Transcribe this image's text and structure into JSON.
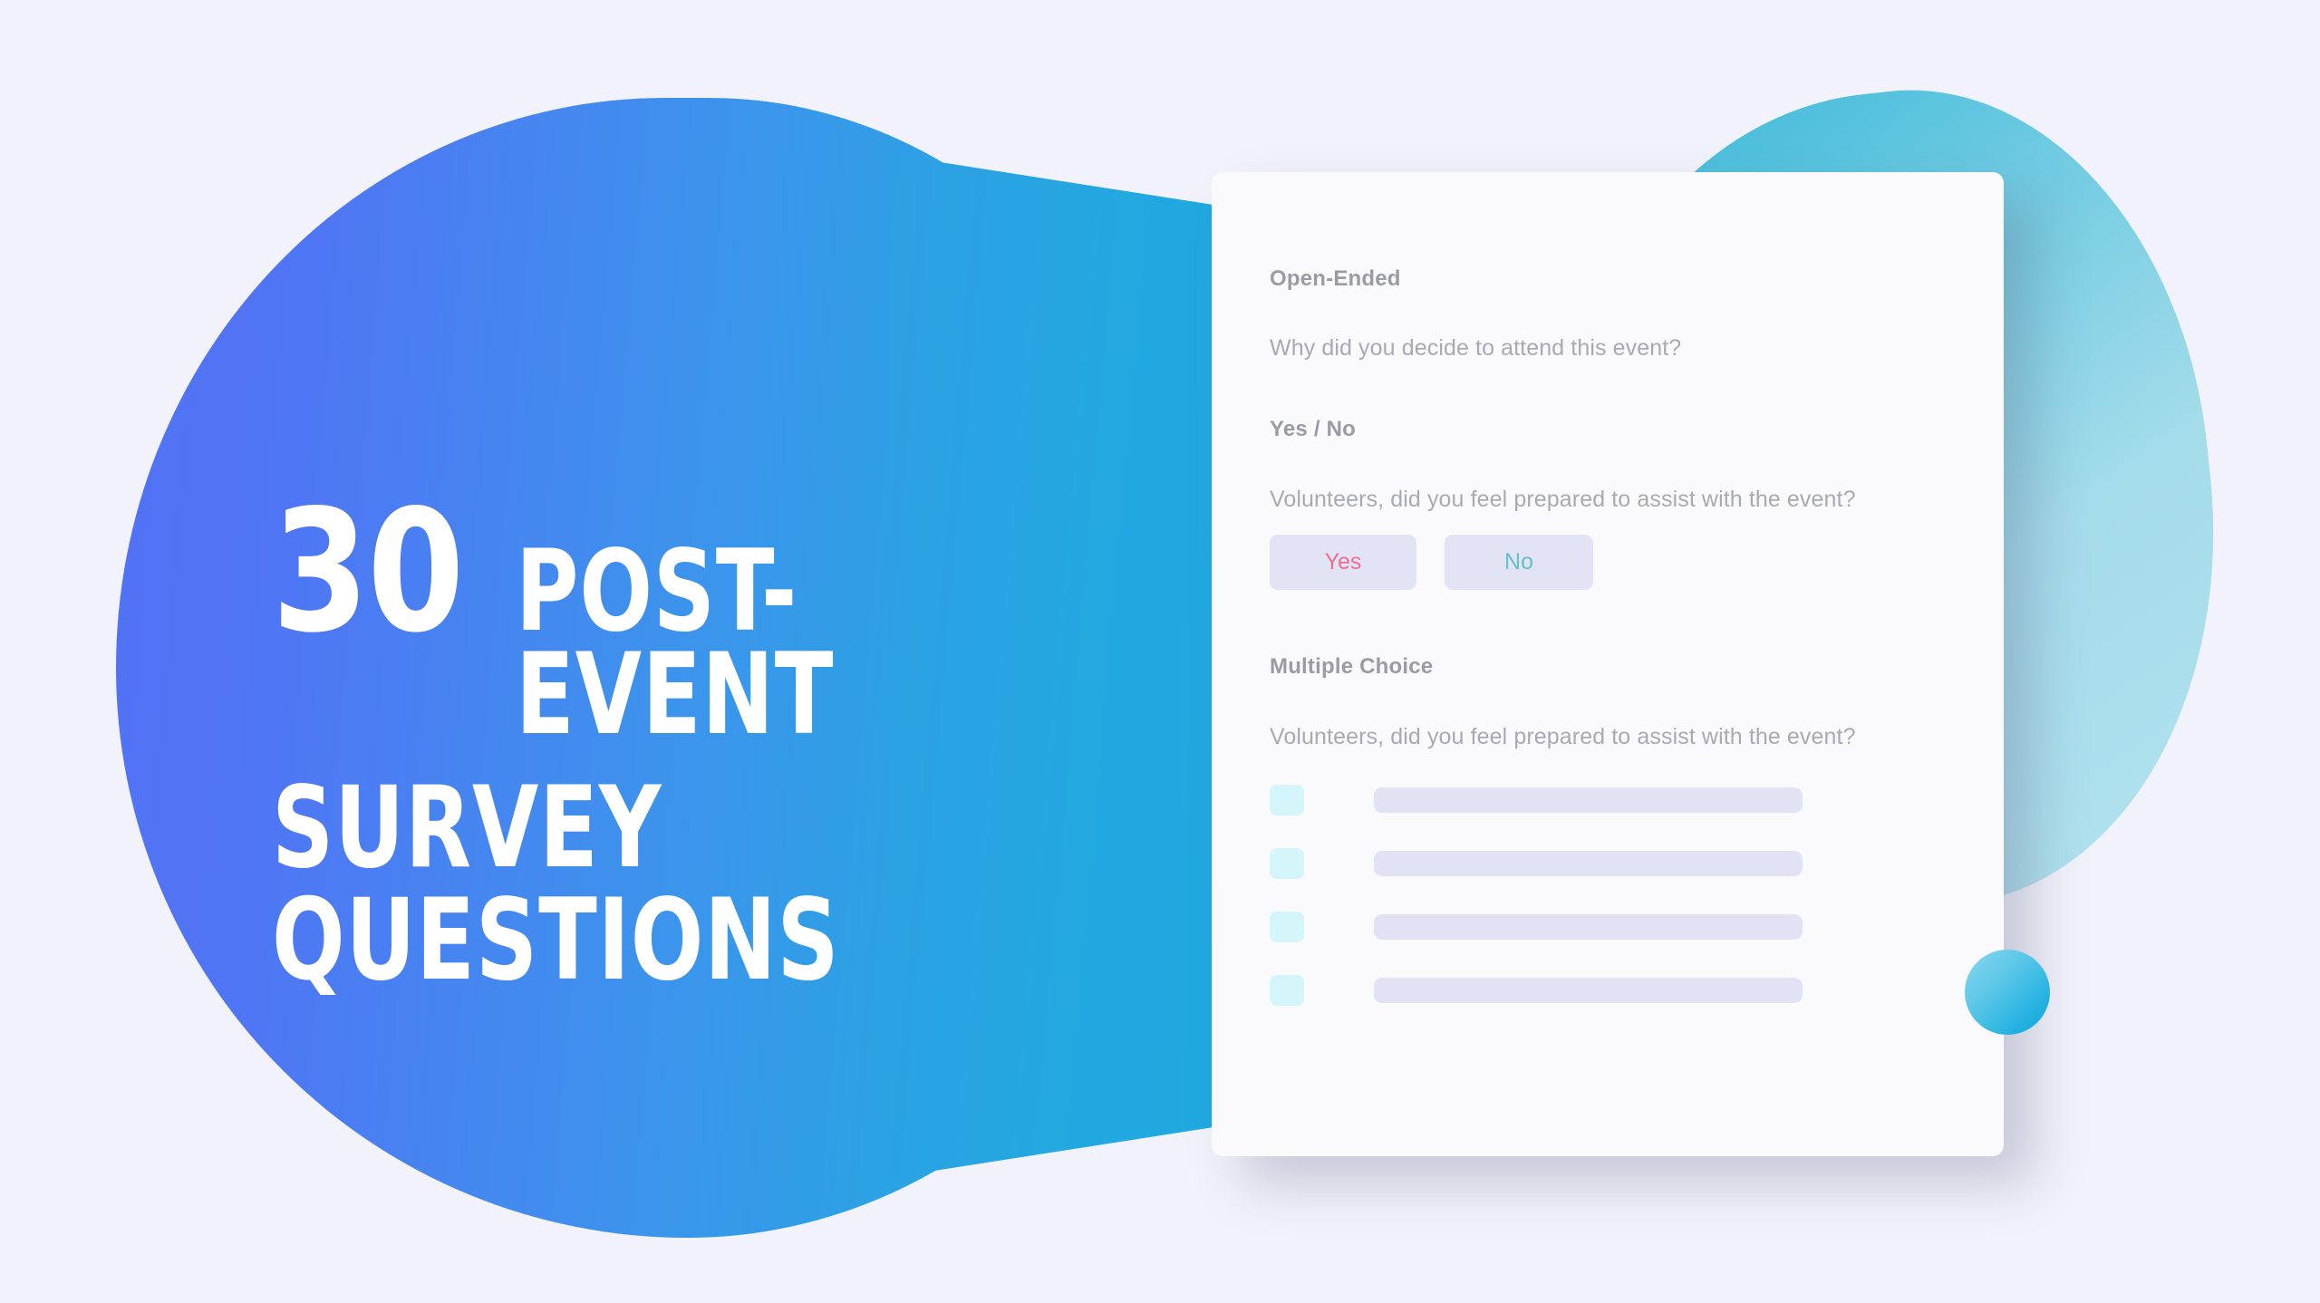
{
  "theme": {
    "page_background": "#f1f2fb",
    "blob_blue_from": "#5271f5",
    "blob_blue_to": "#1fa9df",
    "blob_teal_from": "#35b6d8",
    "blob_teal_to": "#b3e2ef",
    "circle_from": "#8ad7ee",
    "circle_to": "#13a9dd",
    "card_background": "#fafafc",
    "label_color": "#9b9ba6",
    "question_color": "#a9a9b4",
    "button_background": "#e3e3f6",
    "yes_color": "#ef6f8e",
    "no_color": "#63c2c9",
    "checkbox_color": "#d4f6fb",
    "placeholder_bar_color": "#e2e2f5"
  },
  "hero": {
    "count": "30",
    "headline_line1": "POST-EVENT",
    "headline_line2": "SURVEY QUESTIONS"
  },
  "card": {
    "sections": [
      {
        "label": "Open-Ended",
        "question": "Why did you decide to attend this event?"
      },
      {
        "label": "Yes / No",
        "question": "Volunteers, did you feel prepared to assist with the event?",
        "options": [
          {
            "label": "Yes",
            "name": "yes-button"
          },
          {
            "label": "No",
            "name": "no-button"
          }
        ]
      },
      {
        "label": "Multiple Choice",
        "question": "Volunteers, did you feel prepared to assist with the event?",
        "choices": [
          {
            "checked": false
          },
          {
            "checked": false
          },
          {
            "checked": false
          },
          {
            "checked": false
          }
        ]
      }
    ]
  },
  "decorations": {
    "blob_blue": "large-blue-gradient-blob",
    "blob_teal": "teal-gradient-blob",
    "circle_teal": "teal-gradient-circle"
  }
}
